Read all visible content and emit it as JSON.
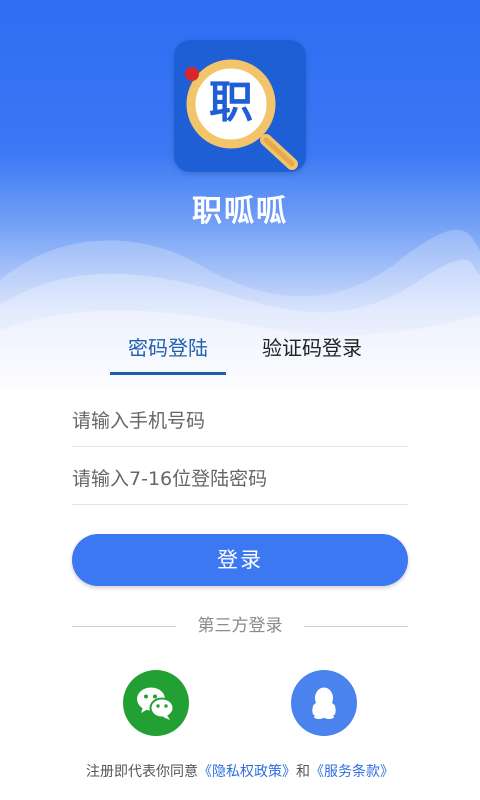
{
  "app": {
    "name": "职呱呱",
    "logo_char": "职"
  },
  "tabs": [
    {
      "label": "密码登陆",
      "active": true
    },
    {
      "label": "验证码登录",
      "active": false
    }
  ],
  "form": {
    "phone_placeholder": "请输入手机号码",
    "password_placeholder": "请输入7-16位登陆密码",
    "login_label": "登录"
  },
  "third_party": {
    "label": "第三方登录",
    "providers": [
      {
        "icon": "wechat-icon",
        "color": "#23a034"
      },
      {
        "icon": "qq-icon",
        "color": "#4a83ee"
      }
    ]
  },
  "agreement": {
    "prefix": "注册即代表你同意",
    "privacy_link": "《隐私权政策》",
    "conjunction": "和",
    "terms_link": "《服务条款》"
  },
  "colors": {
    "primary": "#3b78f2",
    "header": "#2f6df3",
    "tab_active": "#1f5fb0",
    "wechat": "#23a034",
    "qq": "#4a83ee"
  }
}
